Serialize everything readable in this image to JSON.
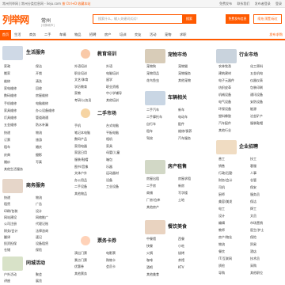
{
  "topbar": {
    "left": "常州列举网 | 常州分类信息网 - lieju.com",
    "ctrl_hint": "按 Ctrl+D 收藏本站",
    "right_links": [
      "免费发布",
      "联系我们",
      "发布者登录",
      "登录"
    ]
  },
  "header": {
    "logo": "列举网",
    "city": "常州",
    "city_sub": "[切换城市]",
    "search_placeholder": "搜索什么，输入关键词试试！",
    "search_button": "搜索",
    "post_button": "免费发布信息",
    "vip_button": "续充/顶置/标红"
  },
  "nav": {
    "items": [
      "首页",
      "生活",
      "商务",
      "二手",
      "车辆",
      "物品",
      "招聘",
      "房产",
      "培训",
      "交友",
      "活动",
      "宠物",
      "求职"
    ],
    "right": "发布求购"
  },
  "sections": {
    "life": {
      "title": "生活服务",
      "items": [
        [
          "家政",
          "保洁"
        ],
        [
          "搬家",
          "开锁"
        ],
        [
          "维修",
          "清洗"
        ],
        [
          "家电维修",
          "回收"
        ],
        [
          "数码维修",
          "房屋维修"
        ],
        [
          "手机维修",
          "电脑维修"
        ],
        [
          "家具维修",
          "办公设备维修"
        ],
        [
          "灯具维修",
          "管道疏通"
        ],
        [
          "五金维修",
          "防水补漏"
        ],
        [
          "快递",
          "物流"
        ],
        [
          "订票",
          "旅游"
        ],
        [
          "租车",
          "婚庆"
        ],
        [
          "庆典",
          "摄影"
        ],
        [
          "婚纱",
          "写真"
        ],
        [
          "其他生活服务",
          ""
        ]
      ]
    },
    "business": {
      "title": "商务服务",
      "items": [
        [
          "快递",
          "物流"
        ],
        [
          "租赁",
          "广告"
        ],
        [
          "印刷/包装",
          "设计"
        ],
        [
          "网站建设",
          "网络推广"
        ],
        [
          "公司注册",
          "代理记账"
        ],
        [
          "财务/会计",
          "法律咨询"
        ],
        [
          "翻译",
          "速记"
        ],
        [
          "投资担保",
          "设备租赁"
        ],
        [
          "仓储",
          "保险"
        ],
        [
          "礼品定制",
          "展会"
        ],
        [
          "其他商务服务",
          ""
        ]
      ]
    },
    "education": {
      "title": "教育培训",
      "items": [
        [
          "外语培训",
          "外语"
        ],
        [
          "职业培训",
          "电脑培训"
        ],
        [
          "文艺/体育",
          "留学"
        ],
        [
          "学历教育",
          "职业资格"
        ],
        [
          "家教",
          "中小学辅导"
        ],
        [
          "考研/公务员",
          "其他培训"
        ]
      ]
    },
    "market": {
      "title": "二手市场",
      "items": [
        [
          "手机",
          "台式电脑"
        ],
        [
          "笔记本电脑",
          "平板电脑"
        ],
        [
          "数码产品",
          "相机"
        ],
        [
          "家用电器",
          "家具"
        ],
        [
          "家居日用",
          "母婴/儿童"
        ],
        [
          "服装/鞋帽",
          "箱包"
        ],
        [
          "图书/音像",
          "乐器"
        ],
        [
          "文体户外",
          "运动器材"
        ],
        [
          "办公用品",
          "设备"
        ],
        [
          "二手设备",
          "工业设备"
        ],
        [
          "其他物品",
          ""
        ]
      ]
    },
    "pets": {
      "title": "宠物市场",
      "items": [
        [
          "宠物狗",
          "宠物猫"
        ],
        [
          "宠物用品",
          "宠物服务"
        ],
        [
          "花鸟鱼虫",
          "其他宠物"
        ]
      ]
    },
    "cars": {
      "title": "车辆相关",
      "items": [
        [
          "二手汽车",
          "新车"
        ],
        [
          "二手摩托车",
          "电动车"
        ],
        [
          "自行车",
          "配件"
        ],
        [
          "租车",
          "维修/保养"
        ],
        [
          "驾校",
          "汽车服务"
        ]
      ]
    },
    "house": {
      "title": "房产租售",
      "items": [
        [
          "房屋出租",
          "房屋求租"
        ],
        [
          "二手房",
          "新房"
        ],
        [
          "商铺",
          "写字楼"
        ],
        [
          "厂房/仓库",
          "土地"
        ],
        [
          "其他房产",
          ""
        ]
      ]
    },
    "food": {
      "title": "餐饮美食",
      "items": [
        [
          "中餐馆",
          "西餐"
        ],
        [
          "快餐",
          "小吃"
        ],
        [
          "火锅",
          "烧烤"
        ],
        [
          "咖啡",
          "茶馆"
        ],
        [
          "酒吧",
          "KTV"
        ],
        [
          "其他美食",
          ""
        ]
      ]
    },
    "tickets": {
      "title": "票务卡券",
      "items": [
        [
          "演出门票",
          "电影票"
        ],
        [
          "景点门票",
          "购物卡"
        ],
        [
          "优惠券",
          "会员卡"
        ],
        [
          "其他票务",
          ""
        ]
      ]
    },
    "events": {
      "title": "同城活动",
      "items": [
        [
          "户外活动",
          "聚会"
        ],
        [
          "讲座",
          "展览"
        ]
      ]
    },
    "industry": {
      "title": "行业市场",
      "items": [
        [
          "农林牧渔",
          "化工原料"
        ],
        [
          "建筑建材",
          "五金机电"
        ],
        [
          "电子元器件",
          "仪器仪表"
        ],
        [
          "纺织皮革",
          "包装印刷"
        ],
        [
          "机械设备",
          "通讯设备"
        ],
        [
          "电气设备",
          "安防设备"
        ],
        [
          "环保设备",
          "能源"
        ],
        [
          "塑料橡胶",
          "冶金矿产"
        ],
        [
          "汽车配件",
          "服装鞋帽"
        ],
        [
          "其他行业",
          ""
        ]
      ]
    },
    "jobs": {
      "title": "企业招聘",
      "items": [
        [
          "普工",
          "技工"
        ],
        [
          "销售",
          "客服"
        ],
        [
          "行政/后勤",
          "人事"
        ],
        [
          "财务/会计",
          "仓管"
        ],
        [
          "司机",
          "保安"
        ],
        [
          "厨师",
          "服务员"
        ],
        [
          "美容/美发",
          "保洁"
        ],
        [
          "电工",
          "焊工"
        ],
        [
          "设计",
          "文员"
        ],
        [
          "编辑",
          "市场营销"
        ],
        [
          "教师",
          "医生/护士"
        ],
        [
          "房产/物业",
          "保险"
        ],
        [
          "物流",
          "贸易"
        ],
        [
          "餐饮",
          "酒店"
        ],
        [
          "IT/互联网",
          "技术员"
        ],
        [
          "质检",
          "采购"
        ],
        [
          "导购",
          "其他职位"
        ]
      ]
    }
  }
}
